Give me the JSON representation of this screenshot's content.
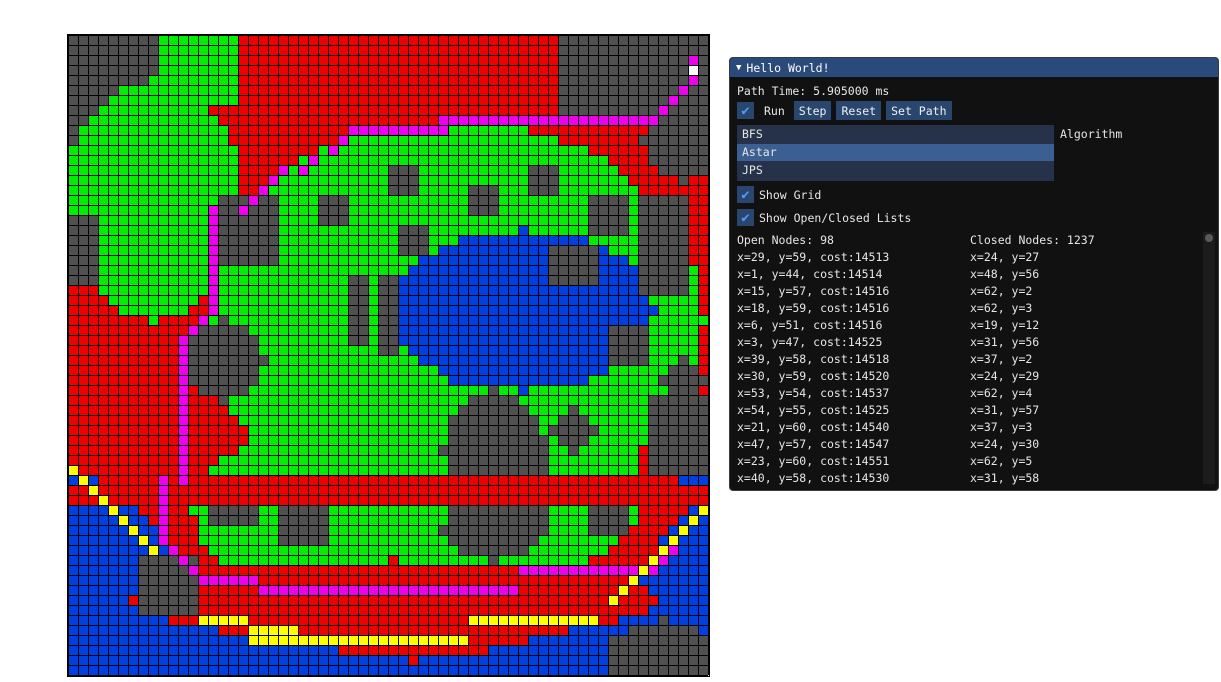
{
  "window": {
    "title": "Hello World!"
  },
  "path_time": "Path Time: 5.905000 ms",
  "controls": {
    "run_label": "Run",
    "run_checked": true,
    "step_label": "Step",
    "reset_label": "Reset",
    "set_path_label": "Set Path"
  },
  "algorithm": {
    "label": "Algorithm",
    "options": [
      "BFS",
      "Astar",
      "JPS"
    ],
    "selected": "Astar"
  },
  "show_grid": {
    "label": "Show Grid",
    "checked": true
  },
  "show_lists": {
    "label": "Show Open/Closed Lists",
    "checked": true
  },
  "open_nodes_header": "Open Nodes: 98",
  "closed_nodes_header": "Closed Nodes: 1237",
  "open_nodes": [
    "x=29, y=59, cost:14513",
    "x=1, y=44, cost:14514",
    "x=15, y=57, cost:14516",
    "x=18, y=59, cost:14516",
    "x=6, y=51, cost:14516",
    "x=3, y=47, cost:14525",
    "x=39, y=58, cost:14518",
    "x=30, y=59, cost:14520",
    "x=53, y=54, cost:14537",
    "x=54, y=55, cost:14525",
    "x=21, y=60, cost:14540",
    "x=47, y=57, cost:14547",
    "x=23, y=60, cost:14551",
    "x=40, y=58, cost:14530"
  ],
  "closed_nodes": [
    "x=24, y=27",
    "x=48, y=56",
    "x=62, y=2",
    "x=62, y=3",
    "x=19, y=12",
    "x=31, y=56",
    "x=37, y=2",
    "x=24, y=29",
    "x=62, y=4",
    "x=31, y=57",
    "x=37, y=3",
    "x=24, y=30",
    "x=62, y=5",
    "x=31, y=58"
  ],
  "grid": {
    "columns": 64,
    "rows": 64,
    "colors": {
      "wall": "#505050",
      "open": "#ee0000",
      "closed": "#00ee00",
      "water": "#0040e0",
      "path": "#ee00ee",
      "frontier": "#ffff00",
      "goal": "#ffffff",
      "grid_line": "#000000"
    }
  }
}
